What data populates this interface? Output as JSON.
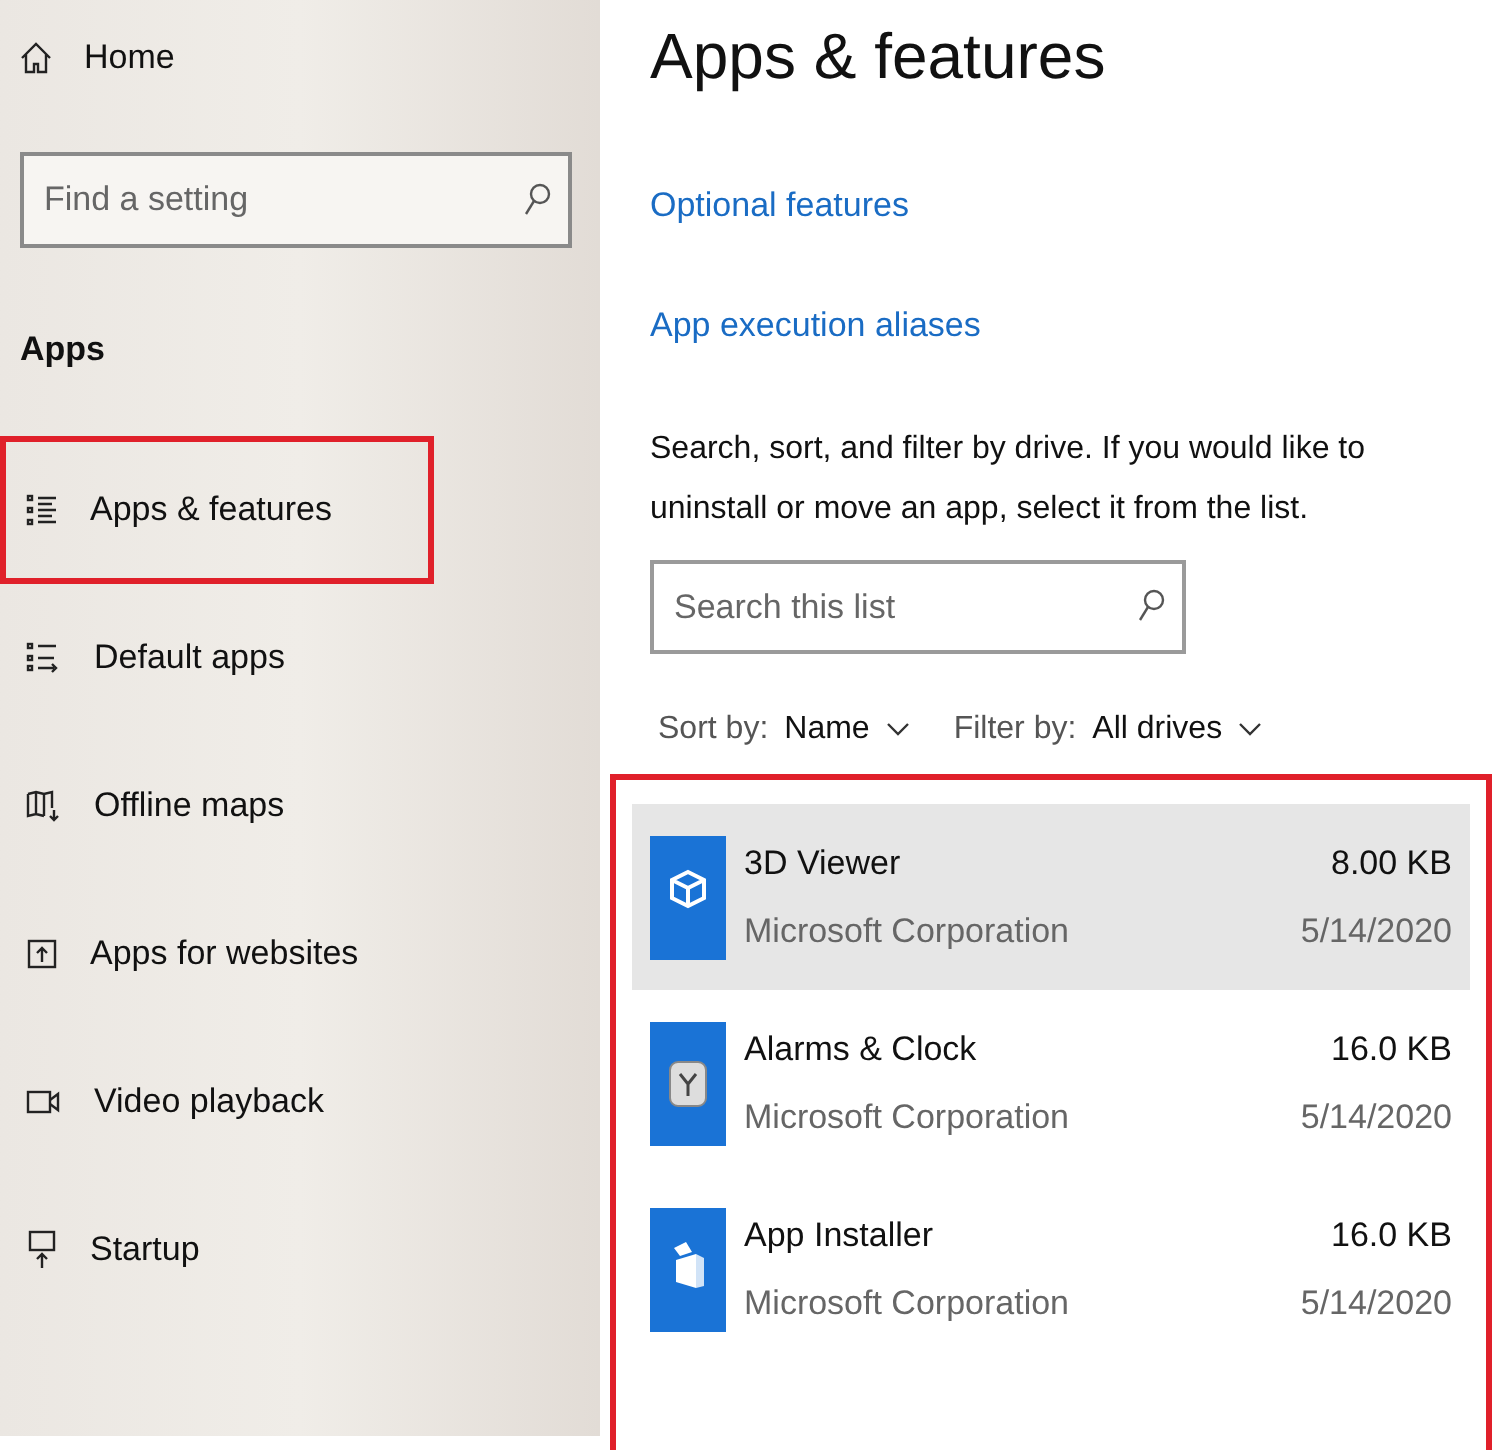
{
  "sidebar": {
    "home": "Home",
    "search": {
      "placeholder": "Find a setting"
    },
    "section": "Apps",
    "items": [
      {
        "label": "Apps & features",
        "kind": "list",
        "highlighted": true
      },
      {
        "label": "Default apps",
        "kind": "default",
        "highlighted": false
      },
      {
        "label": "Offline maps",
        "kind": "map",
        "highlighted": false
      },
      {
        "label": "Apps for websites",
        "kind": "web",
        "highlighted": false
      },
      {
        "label": "Video playback",
        "kind": "video",
        "highlighted": false
      },
      {
        "label": "Startup",
        "kind": "startup",
        "highlighted": false
      }
    ]
  },
  "main": {
    "title": "Apps & features",
    "links": [
      "Optional features",
      "App execution aliases"
    ],
    "description": "Search, sort, and filter by drive. If you would like to uninstall or move an app, select it from the list.",
    "search": {
      "placeholder": "Search this list"
    },
    "sort": {
      "label": "Sort by:",
      "value": "Name"
    },
    "filter": {
      "label": "Filter by:",
      "value": "All drives"
    },
    "list_highlighted": true,
    "apps": [
      {
        "name": "3D Viewer",
        "publisher": "Microsoft Corporation",
        "size": "8.00 KB",
        "date": "5/14/2020",
        "kind": "cube",
        "selected": true
      },
      {
        "name": "Alarms & Clock",
        "publisher": "Microsoft Corporation",
        "size": "16.0 KB",
        "date": "5/14/2020",
        "kind": "clock",
        "selected": false
      },
      {
        "name": "App Installer",
        "publisher": "Microsoft Corporation",
        "size": "16.0 KB",
        "date": "5/14/2020",
        "kind": "box",
        "selected": false
      }
    ]
  }
}
